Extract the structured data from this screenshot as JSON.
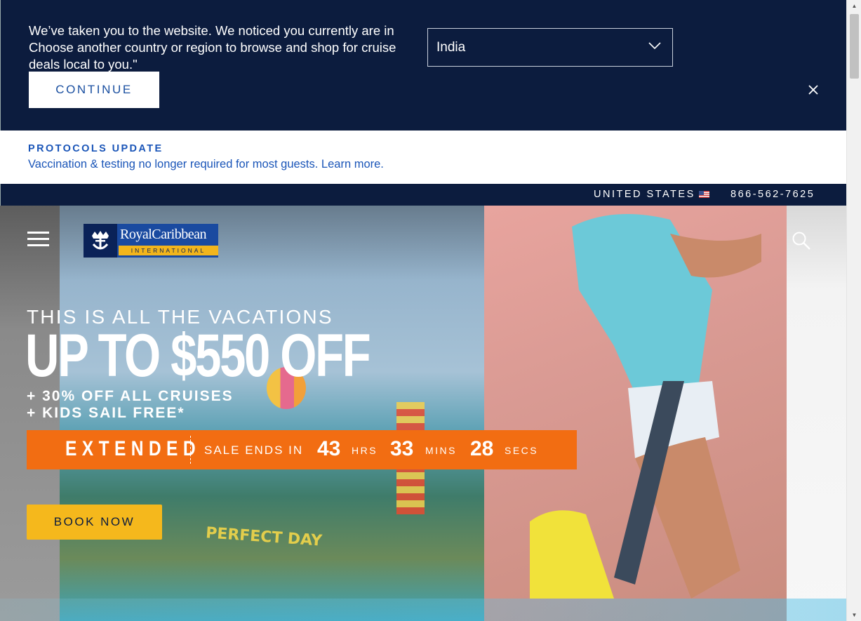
{
  "geo_banner": {
    "message": "We’ve taken you to the website. We noticed you currently are in Choose another country or region to browse and shop for cruise deals local to you.\"",
    "selected_country": "India",
    "continue_label": "CONTINUE"
  },
  "protocols": {
    "title": "PROTOCOLS UPDATE",
    "text": "Vaccination & testing no longer required for most guests. Learn more."
  },
  "utility_bar": {
    "country": "UNITED STATES",
    "phone": "866-562-7625"
  },
  "header": {
    "logo_name": "RoyalCaribbean",
    "logo_sub": "INTERNATIONAL"
  },
  "hero": {
    "eyebrow": "THIS IS ALL THE VACATIONS",
    "headline": "UP TO $550 OFF",
    "sub1": "+ 30% OFF ALL CRUISES",
    "sub2": "+ KIDS SAIL FREE*",
    "scene_text": "PERFECT DAY",
    "countdown": {
      "badge": "EXTENDED",
      "label": "SALE ENDS IN",
      "hours": "43",
      "hours_unit": "HRS",
      "mins": "33",
      "mins_unit": "MINS",
      "secs": "28",
      "secs_unit": "SECS"
    },
    "cta_label": "BOOK NOW"
  },
  "colors": {
    "navy": "#0c1c3e",
    "link_blue": "#1a55b8",
    "orange": "#f26d12",
    "gold": "#f5b81c"
  }
}
